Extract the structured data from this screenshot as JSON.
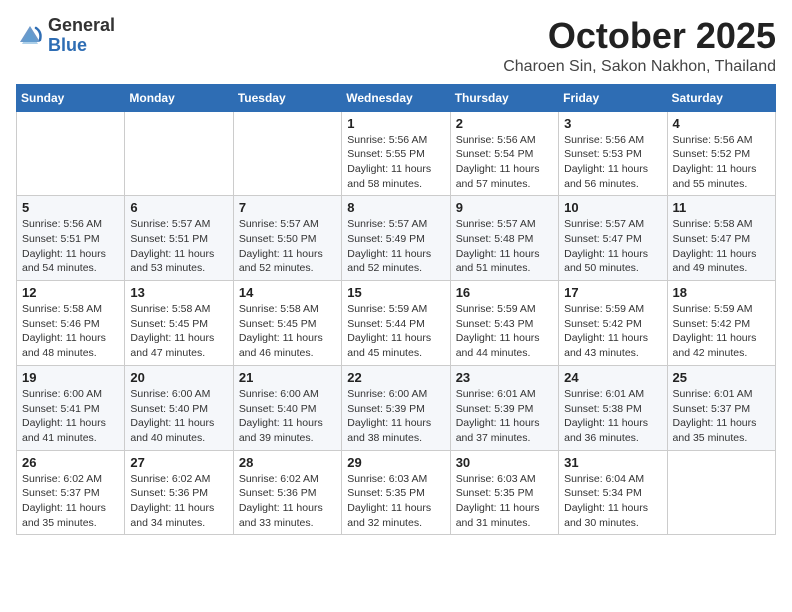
{
  "header": {
    "logo_general": "General",
    "logo_blue": "Blue",
    "month_title": "October 2025",
    "location": "Charoen Sin, Sakon Nakhon, Thailand"
  },
  "weekdays": [
    "Sunday",
    "Monday",
    "Tuesday",
    "Wednesday",
    "Thursday",
    "Friday",
    "Saturday"
  ],
  "weeks": [
    [
      {
        "day": "",
        "info": ""
      },
      {
        "day": "",
        "info": ""
      },
      {
        "day": "",
        "info": ""
      },
      {
        "day": "1",
        "info": "Sunrise: 5:56 AM\nSunset: 5:55 PM\nDaylight: 11 hours\nand 58 minutes."
      },
      {
        "day": "2",
        "info": "Sunrise: 5:56 AM\nSunset: 5:54 PM\nDaylight: 11 hours\nand 57 minutes."
      },
      {
        "day": "3",
        "info": "Sunrise: 5:56 AM\nSunset: 5:53 PM\nDaylight: 11 hours\nand 56 minutes."
      },
      {
        "day": "4",
        "info": "Sunrise: 5:56 AM\nSunset: 5:52 PM\nDaylight: 11 hours\nand 55 minutes."
      }
    ],
    [
      {
        "day": "5",
        "info": "Sunrise: 5:56 AM\nSunset: 5:51 PM\nDaylight: 11 hours\nand 54 minutes."
      },
      {
        "day": "6",
        "info": "Sunrise: 5:57 AM\nSunset: 5:51 PM\nDaylight: 11 hours\nand 53 minutes."
      },
      {
        "day": "7",
        "info": "Sunrise: 5:57 AM\nSunset: 5:50 PM\nDaylight: 11 hours\nand 52 minutes."
      },
      {
        "day": "8",
        "info": "Sunrise: 5:57 AM\nSunset: 5:49 PM\nDaylight: 11 hours\nand 52 minutes."
      },
      {
        "day": "9",
        "info": "Sunrise: 5:57 AM\nSunset: 5:48 PM\nDaylight: 11 hours\nand 51 minutes."
      },
      {
        "day": "10",
        "info": "Sunrise: 5:57 AM\nSunset: 5:47 PM\nDaylight: 11 hours\nand 50 minutes."
      },
      {
        "day": "11",
        "info": "Sunrise: 5:58 AM\nSunset: 5:47 PM\nDaylight: 11 hours\nand 49 minutes."
      }
    ],
    [
      {
        "day": "12",
        "info": "Sunrise: 5:58 AM\nSunset: 5:46 PM\nDaylight: 11 hours\nand 48 minutes."
      },
      {
        "day": "13",
        "info": "Sunrise: 5:58 AM\nSunset: 5:45 PM\nDaylight: 11 hours\nand 47 minutes."
      },
      {
        "day": "14",
        "info": "Sunrise: 5:58 AM\nSunset: 5:45 PM\nDaylight: 11 hours\nand 46 minutes."
      },
      {
        "day": "15",
        "info": "Sunrise: 5:59 AM\nSunset: 5:44 PM\nDaylight: 11 hours\nand 45 minutes."
      },
      {
        "day": "16",
        "info": "Sunrise: 5:59 AM\nSunset: 5:43 PM\nDaylight: 11 hours\nand 44 minutes."
      },
      {
        "day": "17",
        "info": "Sunrise: 5:59 AM\nSunset: 5:42 PM\nDaylight: 11 hours\nand 43 minutes."
      },
      {
        "day": "18",
        "info": "Sunrise: 5:59 AM\nSunset: 5:42 PM\nDaylight: 11 hours\nand 42 minutes."
      }
    ],
    [
      {
        "day": "19",
        "info": "Sunrise: 6:00 AM\nSunset: 5:41 PM\nDaylight: 11 hours\nand 41 minutes."
      },
      {
        "day": "20",
        "info": "Sunrise: 6:00 AM\nSunset: 5:40 PM\nDaylight: 11 hours\nand 40 minutes."
      },
      {
        "day": "21",
        "info": "Sunrise: 6:00 AM\nSunset: 5:40 PM\nDaylight: 11 hours\nand 39 minutes."
      },
      {
        "day": "22",
        "info": "Sunrise: 6:00 AM\nSunset: 5:39 PM\nDaylight: 11 hours\nand 38 minutes."
      },
      {
        "day": "23",
        "info": "Sunrise: 6:01 AM\nSunset: 5:39 PM\nDaylight: 11 hours\nand 37 minutes."
      },
      {
        "day": "24",
        "info": "Sunrise: 6:01 AM\nSunset: 5:38 PM\nDaylight: 11 hours\nand 36 minutes."
      },
      {
        "day": "25",
        "info": "Sunrise: 6:01 AM\nSunset: 5:37 PM\nDaylight: 11 hours\nand 35 minutes."
      }
    ],
    [
      {
        "day": "26",
        "info": "Sunrise: 6:02 AM\nSunset: 5:37 PM\nDaylight: 11 hours\nand 35 minutes."
      },
      {
        "day": "27",
        "info": "Sunrise: 6:02 AM\nSunset: 5:36 PM\nDaylight: 11 hours\nand 34 minutes."
      },
      {
        "day": "28",
        "info": "Sunrise: 6:02 AM\nSunset: 5:36 PM\nDaylight: 11 hours\nand 33 minutes."
      },
      {
        "day": "29",
        "info": "Sunrise: 6:03 AM\nSunset: 5:35 PM\nDaylight: 11 hours\nand 32 minutes."
      },
      {
        "day": "30",
        "info": "Sunrise: 6:03 AM\nSunset: 5:35 PM\nDaylight: 11 hours\nand 31 minutes."
      },
      {
        "day": "31",
        "info": "Sunrise: 6:04 AM\nSunset: 5:34 PM\nDaylight: 11 hours\nand 30 minutes."
      },
      {
        "day": "",
        "info": ""
      }
    ]
  ]
}
